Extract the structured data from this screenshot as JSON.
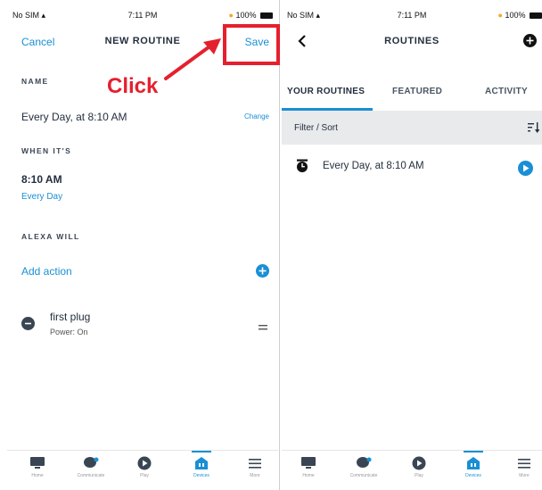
{
  "status_bar": {
    "left": "No SIM",
    "time": "7:11 PM",
    "battery": "100%"
  },
  "left": {
    "nav": {
      "cancel": "Cancel",
      "title": "NEW ROUTINE",
      "save": "Save"
    },
    "annotation": {
      "click_label": "Click",
      "accent_color": "#e5202e"
    },
    "name_section": {
      "label": "NAME",
      "value": "Every Day, at 8:10 AM",
      "change": "Change"
    },
    "when_section": {
      "label": "WHEN IT'S",
      "time": "8:10 AM",
      "repeat": "Every Day"
    },
    "alexa_section": {
      "label": "ALEXA WILL",
      "add_action": "Add action"
    },
    "action": {
      "name": "first plug",
      "detail": "Power: On"
    }
  },
  "right": {
    "nav": {
      "title": "ROUTINES"
    },
    "tabs": [
      {
        "label": "YOUR ROUTINES",
        "active": true
      },
      {
        "label": "FEATURED",
        "active": false
      },
      {
        "label": "ACTIVITY",
        "active": false
      }
    ],
    "filter": {
      "label": "Filter / Sort"
    },
    "routines": [
      {
        "name": "Every Day, at 8:10 AM"
      }
    ]
  },
  "tabbar": {
    "items": [
      {
        "label": "Home",
        "icon": "home-icon"
      },
      {
        "label": "Communicate",
        "icon": "chat-bubble-icon"
      },
      {
        "label": "Play",
        "icon": "play-icon"
      },
      {
        "label": "Devices",
        "icon": "devices-icon"
      },
      {
        "label": "More",
        "icon": "menu-icon"
      }
    ],
    "active_index": 3
  },
  "colors": {
    "accent": "#1a8fd4",
    "text": "#232f3e",
    "filter_bg": "#e8eaec"
  }
}
